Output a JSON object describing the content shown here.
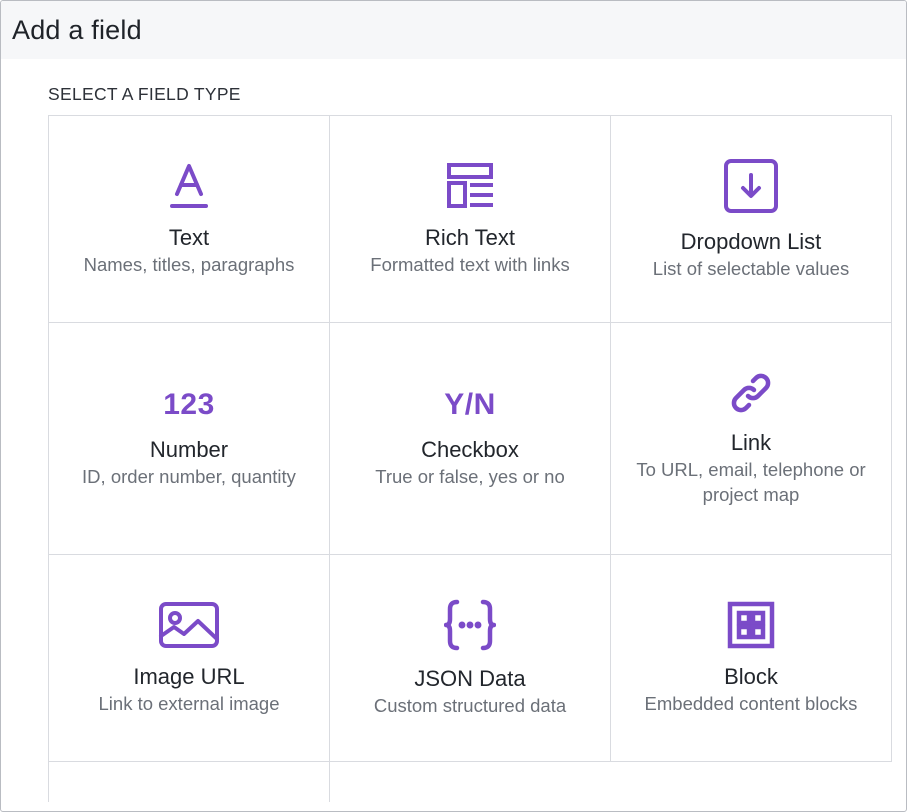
{
  "dialog": {
    "title": "Add a field",
    "section_label": "SELECT A FIELD TYPE"
  },
  "colors": {
    "accent": "#7b4bc8",
    "header_bg": "#f6f7f9",
    "border": "#d9dbe0"
  },
  "field_types": [
    {
      "name": "Text",
      "description": "Names, titles, paragraphs",
      "icon": "text-icon"
    },
    {
      "name": "Rich Text",
      "description": "Formatted text with links",
      "icon": "rich-text-icon"
    },
    {
      "name": "Dropdown List",
      "description": "List of selectable values",
      "icon": "dropdown-icon"
    },
    {
      "name": "Number",
      "description": "ID, order number, quantity",
      "icon": "number-icon",
      "glyph": "123"
    },
    {
      "name": "Checkbox",
      "description": "True or false, yes or no",
      "icon": "checkbox-icon",
      "glyph": "Y/N"
    },
    {
      "name": "Link",
      "description": "To URL, email, telephone or project map",
      "icon": "link-icon"
    },
    {
      "name": "Image URL",
      "description": "Link to external image",
      "icon": "image-icon"
    },
    {
      "name": "JSON Data",
      "description": "Custom structured data",
      "icon": "json-icon"
    },
    {
      "name": "Block",
      "description": "Embedded content blocks",
      "icon": "block-icon"
    }
  ]
}
